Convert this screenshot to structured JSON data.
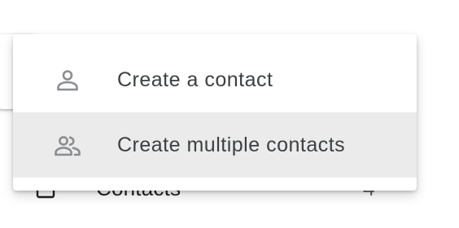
{
  "menu": {
    "items": [
      {
        "label": "Create a contact",
        "icon": "person-outline-icon"
      },
      {
        "label": "Create multiple contacts",
        "icon": "people-outline-icon",
        "highlighted": true
      }
    ]
  },
  "sidebar": {
    "contacts_label": "Contacts",
    "contacts_count": "4",
    "contacts_icon": "person-box-icon"
  },
  "colors": {
    "menu_text": "#3c4043",
    "icon": "#8a8d91",
    "hover_bg": "#ebebeb"
  }
}
